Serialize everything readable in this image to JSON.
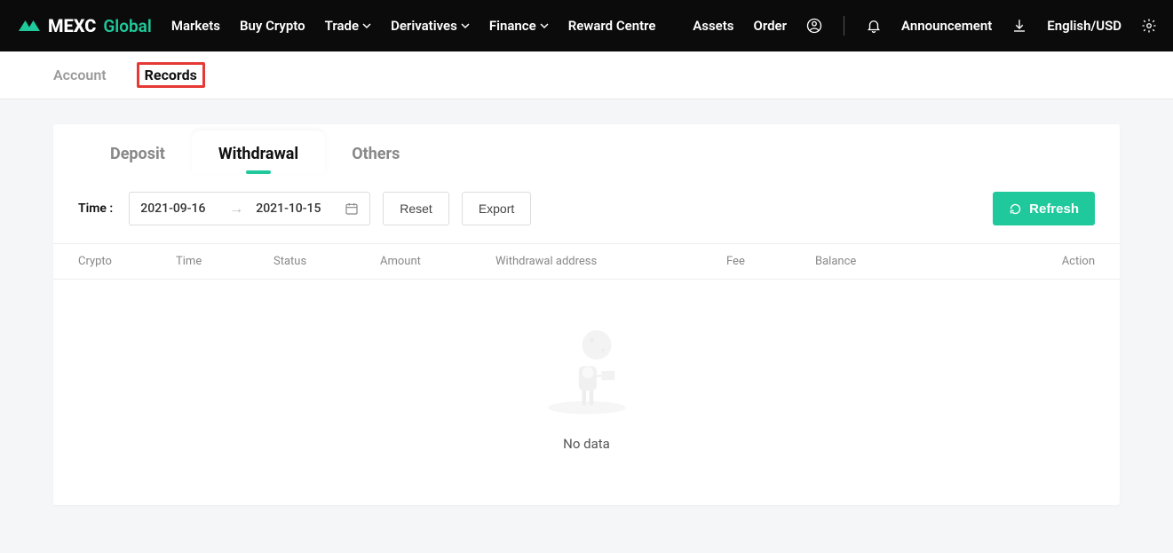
{
  "colors": {
    "accent": "#1fc99b",
    "highlight_border": "#e53935"
  },
  "logo": {
    "text1": "MEXC",
    "text2": "Global"
  },
  "nav": {
    "left": [
      "Markets",
      "Buy Crypto",
      "Trade",
      "Derivatives",
      "Finance",
      "Reward Centre"
    ],
    "right_links": [
      "Assets",
      "Order"
    ],
    "announcement": "Announcement",
    "locale": "English/USD"
  },
  "subnav": {
    "account": "Account",
    "records": "Records",
    "active": "records"
  },
  "inner_tabs": {
    "deposit": "Deposit",
    "withdrawal": "Withdrawal",
    "others": "Others",
    "active": "withdrawal"
  },
  "filter": {
    "time_label": "Time :",
    "date_start": "2021-09-16",
    "date_end": "2021-10-15",
    "reset": "Reset",
    "export": "Export",
    "refresh": "Refresh"
  },
  "table": {
    "headers": {
      "crypto": "Crypto",
      "time": "Time",
      "status": "Status",
      "amount": "Amount",
      "address": "Withdrawal address",
      "fee": "Fee",
      "balance": "Balance",
      "action": "Action"
    },
    "rows": []
  },
  "empty": {
    "no_data": "No data"
  }
}
